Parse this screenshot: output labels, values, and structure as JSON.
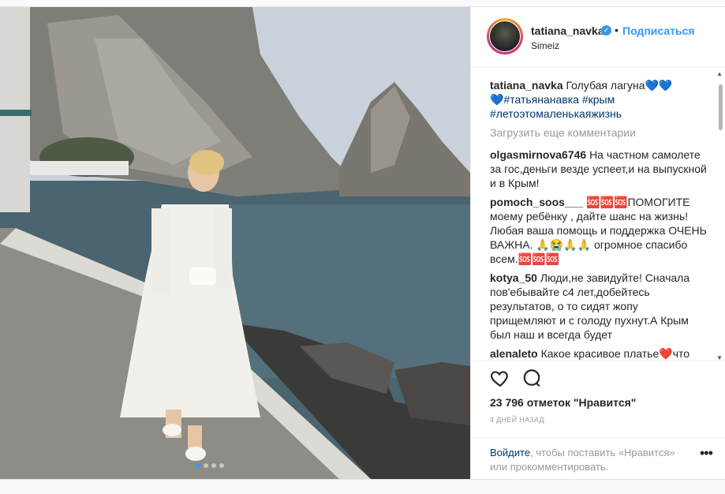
{
  "post": {
    "username": "tatiana_navka",
    "follow_label": "Подписаться",
    "location": "Simeiz",
    "caption": {
      "username": "tatiana_navka",
      "text": "Голубая лагуна💙💙",
      "hashtags_line1": "💙#татьянанавка #крым",
      "hashtags_line2": "#летоэтомаленькаяжизнь"
    },
    "load_more": "Загрузить еще комментарии",
    "comments": [
      {
        "user": "olgasmirnova6746",
        "text": "На частном самолете за гос,деньги везде успеет,и на выпускной и в Крым!"
      },
      {
        "user": "pomoch_soos___",
        "text": "🆘🆘🆘ПОМОГИТЕ моему ребёнку , дайте шанс на жизнь! Любая ваша помощь и поддержка ОЧЕНЬ ВАЖНА. 🙏😭🙏🙏 огромное спасибо всем.🆘🆘🆘"
      },
      {
        "user": "kotya_50",
        "text": "Люди,не завидуйте! Сначала пов'ебывайте с4 лет,добейтесь результатов, о то сидят жопу прищемляют и с голоду пухнут.А Крым был наш и всегда будет"
      },
      {
        "user": "alenaleto",
        "text": "Какое красивое платье❤️что"
      }
    ],
    "likes": "23 796 отметок \"Нравится\"",
    "time": "4 ДНЕЙ НАЗАД",
    "login_link": "Войдите",
    "login_text_1": ", чтобы поставить «Нравится»",
    "login_text_2": "или прокомментировать.",
    "more_label": "•••",
    "icons": {
      "heart": "heart-icon",
      "comment": "comment-icon",
      "verified": "verified-badge-icon",
      "more": "more-options-icon"
    },
    "colors": {
      "link": "#3897f0",
      "hashtag": "#003569",
      "muted": "#999999"
    }
  }
}
